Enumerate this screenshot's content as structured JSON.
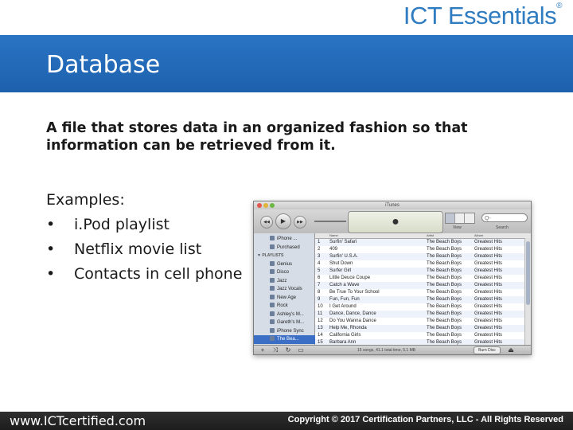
{
  "brand": {
    "logo_text": "ICT Essentials",
    "tm": "®"
  },
  "slide": {
    "title": "Database",
    "definition": "A file that stores data in an organized fashion so that information can be retrieved from it.",
    "examples_heading": "Examples:",
    "examples": [
      "i.Pod playlist",
      "Netflix movie list",
      "Contacts in cell phone"
    ]
  },
  "itunes": {
    "window_title": "iTunes",
    "view_label": "View",
    "search_label": "Search",
    "search_placeholder": "Q-",
    "sidebar": [
      {
        "label": "iPhone ...",
        "type": "item"
      },
      {
        "label": "Purchased",
        "type": "item"
      },
      {
        "label": "▼ PLAYLISTS",
        "type": "head"
      },
      {
        "label": "Genius",
        "type": "item"
      },
      {
        "label": "Disco",
        "type": "item"
      },
      {
        "label": "Jazz",
        "type": "item"
      },
      {
        "label": "Jazz Vocals",
        "type": "item"
      },
      {
        "label": "New Age",
        "type": "item"
      },
      {
        "label": "Rock",
        "type": "item"
      },
      {
        "label": "Ashley's M...",
        "type": "item"
      },
      {
        "label": "Gareth's M...",
        "type": "item"
      },
      {
        "label": "iPhone Sync",
        "type": "item"
      },
      {
        "label": "The Bea...",
        "type": "selected"
      }
    ],
    "columns": {
      "name": "Name",
      "artist": "Artist",
      "album": "Album"
    },
    "rows": [
      {
        "n": "1",
        "name": "Surfin' Safari",
        "artist": "The Beach Boys",
        "album": "Greatest Hits"
      },
      {
        "n": "2",
        "name": "409",
        "artist": "The Beach Boys",
        "album": "Greatest Hits"
      },
      {
        "n": "3",
        "name": "Surfin' U.S.A.",
        "artist": "The Beach Boys",
        "album": "Greatest Hits"
      },
      {
        "n": "4",
        "name": "Shut Down",
        "artist": "The Beach Boys",
        "album": "Greatest Hits"
      },
      {
        "n": "5",
        "name": "Surfer Girl",
        "artist": "The Beach Boys",
        "album": "Greatest Hits"
      },
      {
        "n": "6",
        "name": "Little Deuce Coupe",
        "artist": "The Beach Boys",
        "album": "Greatest Hits"
      },
      {
        "n": "7",
        "name": "Catch a Wave",
        "artist": "The Beach Boys",
        "album": "Greatest Hits"
      },
      {
        "n": "8",
        "name": "Be True To Your School",
        "artist": "The Beach Boys",
        "album": "Greatest Hits"
      },
      {
        "n": "9",
        "name": "Fun, Fun, Fun",
        "artist": "The Beach Boys",
        "album": "Greatest Hits"
      },
      {
        "n": "10",
        "name": "I Get Around",
        "artist": "The Beach Boys",
        "album": "Greatest Hits"
      },
      {
        "n": "11",
        "name": "Dance, Dance, Dance",
        "artist": "The Beach Boys",
        "album": "Greatest Hits"
      },
      {
        "n": "12",
        "name": "Do You Wanna Dance",
        "artist": "The Beach Boys",
        "album": "Greatest Hits"
      },
      {
        "n": "13",
        "name": "Help Me, Rhonda",
        "artist": "The Beach Boys",
        "album": "Greatest Hits"
      },
      {
        "n": "14",
        "name": "California Girls",
        "artist": "The Beach Boys",
        "album": "Greatest Hits"
      },
      {
        "n": "15",
        "name": "Barbara Ann",
        "artist": "The Beach Boys",
        "album": "Greatest Hits"
      }
    ],
    "status": "15 songs, 41.1 total time, 5.1 MB",
    "burn_label": "Burn Disc",
    "controls": {
      "prev": "◀◀",
      "play": "▶",
      "next": "▶▶",
      "lcd_icon": ""
    }
  },
  "footer": {
    "website": "www.ICTcertified.com",
    "copyright": "Copyright © 2017 Certification Partners, LLC - All Rights Reserved"
  }
}
